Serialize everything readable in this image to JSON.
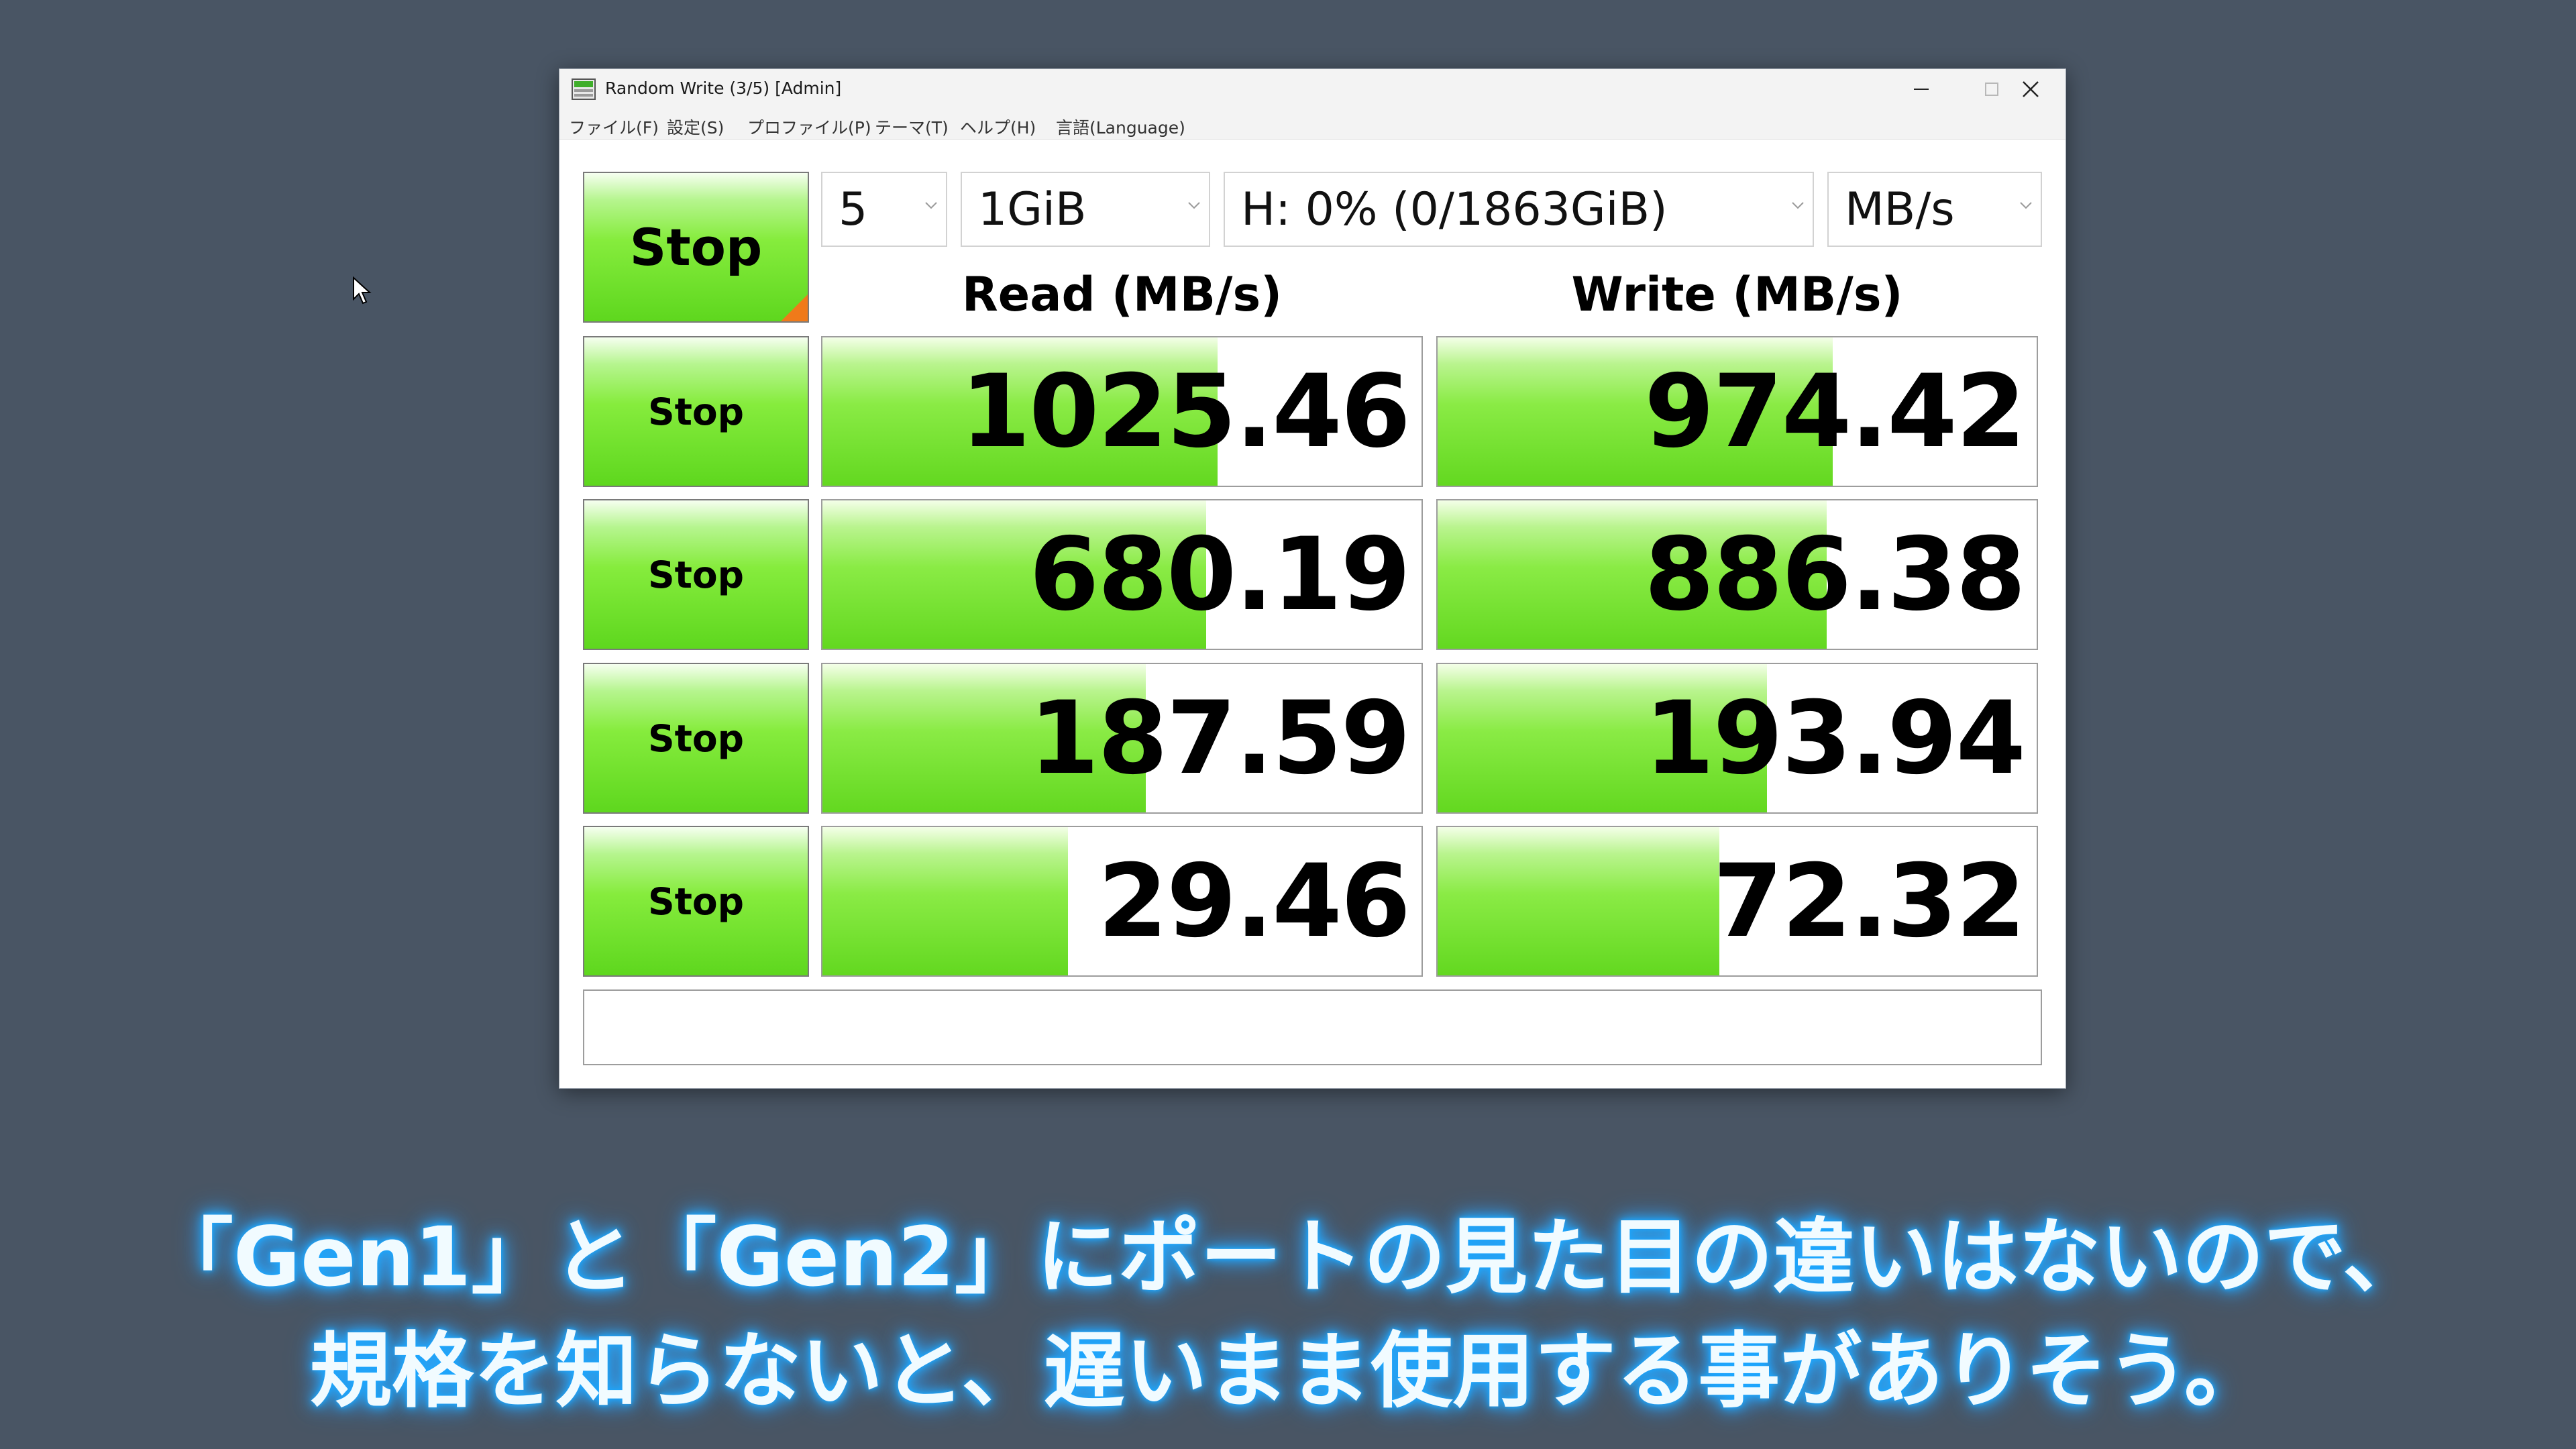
{
  "window": {
    "title": "Random Write (3/5) [Admin]",
    "menu": [
      "ファイル(F)",
      "設定(S)",
      "プロファイル(P)",
      "テーマ(T)",
      "ヘルプ(H)",
      "言語(Language)"
    ]
  },
  "controls": {
    "main_button": "Stop",
    "count": "5",
    "size": "1GiB",
    "drive": "H: 0% (0/1863GiB)",
    "unit": "MB/s"
  },
  "headers": {
    "read": "Read (MB/s)",
    "write": "Write (MB/s)"
  },
  "rows": [
    {
      "button": "Stop",
      "read": "1025.46",
      "write": "974.42",
      "read_fill": 0.66,
      "write_fill": 0.66
    },
    {
      "button": "Stop",
      "read": "680.19",
      "write": "886.38",
      "read_fill": 0.64,
      "write_fill": 0.65
    },
    {
      "button": "Stop",
      "read": "187.59",
      "write": "193.94",
      "read_fill": 0.54,
      "write_fill": 0.55
    },
    {
      "button": "Stop",
      "read": "29.46",
      "write": "72.32",
      "read_fill": 0.41,
      "write_fill": 0.47
    }
  ],
  "comment": "",
  "caption": {
    "line1": "「Gen1」と「Gen2」にポートの見た目の違いはないので、",
    "line2": "規格を知らないと、遅いまま使用する事がありそう。"
  },
  "colors": {
    "bar_green": "#63d820",
    "corner_orange": "#f07a1a",
    "desktop": "#495564",
    "caption_glow": "#1aa6ff"
  }
}
